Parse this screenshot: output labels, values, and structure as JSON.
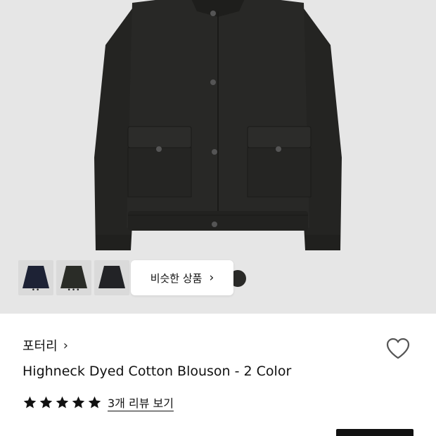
{
  "product_image": {
    "thumbnails": [
      {
        "color_hex": "#1d2235",
        "indicator": "••"
      },
      {
        "color_hex": "#2a2c27",
        "indicator": "•••"
      },
      {
        "color_hex": "#222326",
        "indicator": ""
      }
    ],
    "similar_button_label": "비슷한 상품",
    "similar_chevron": "›"
  },
  "brand": {
    "name": "포터리",
    "chevron": "›"
  },
  "product": {
    "title": "Highneck Dyed Cotton Blouson - 2 Color"
  },
  "rating": {
    "stars": 5,
    "review_link_label": "3개 리뷰 보기"
  },
  "colors": {
    "hero_bg": "#e6e6e6",
    "jacket": "#262624",
    "star": "#111111"
  }
}
